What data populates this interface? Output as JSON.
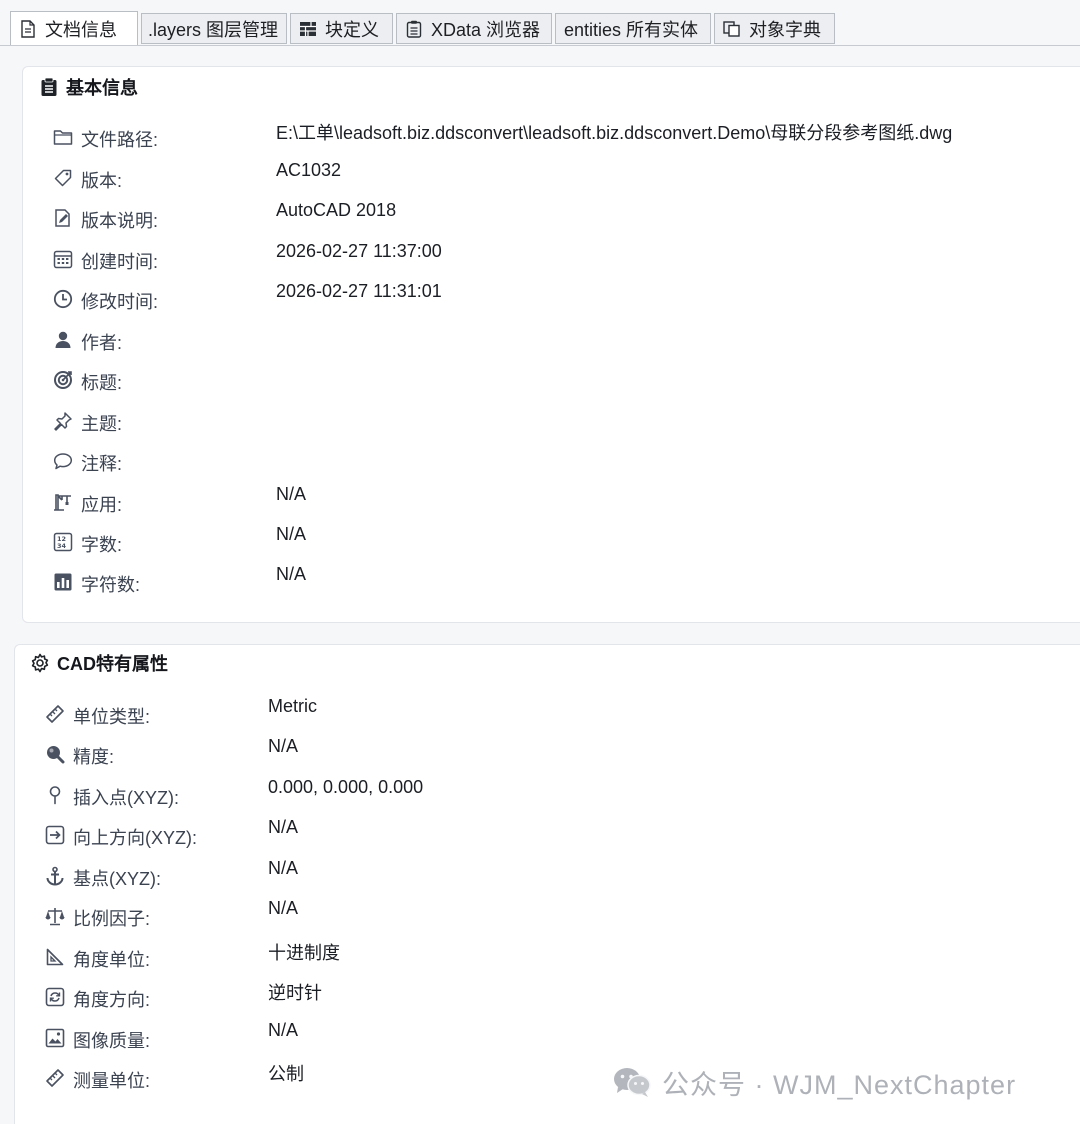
{
  "tabs": [
    {
      "label": "文档信息",
      "icon": "document-icon",
      "active": true
    },
    {
      "label": ".layers 图层管理",
      "icon": "",
      "active": false
    },
    {
      "label": "块定义",
      "icon": "block-table-icon",
      "active": false
    },
    {
      "label": "XData 浏览器",
      "icon": "clipboard-list-icon",
      "active": false
    },
    {
      "label": "entities 所有实体",
      "icon": "",
      "active": false
    },
    {
      "label": "对象字典",
      "icon": "copy-icon",
      "active": false
    }
  ],
  "basic_info": {
    "title": "基本信息",
    "title_icon": "clipboard-icon",
    "rows": [
      {
        "icon": "folder-icon",
        "label": "文件路径:",
        "value": "E:\\工单\\leadsoft.biz.ddsconvert\\leadsoft.biz.ddsconvert.Demo\\母联分段参考图纸.dwg"
      },
      {
        "icon": "tag-icon",
        "label": "版本:",
        "value": "AC1032"
      },
      {
        "icon": "edit-document-icon",
        "label": "版本说明:",
        "value": "AutoCAD 2018"
      },
      {
        "icon": "calendar-icon",
        "label": "创建时间:",
        "value": "2026-02-27 11:37:00"
      },
      {
        "icon": "clock-icon",
        "label": "修改时间:",
        "value": "2026-02-27 11:31:01"
      },
      {
        "icon": "user-icon",
        "label": "作者:",
        "value": ""
      },
      {
        "icon": "target-icon",
        "label": "标题:",
        "value": ""
      },
      {
        "icon": "pin-icon",
        "label": "主题:",
        "value": ""
      },
      {
        "icon": "comment-icon",
        "label": "注释:",
        "value": ""
      },
      {
        "icon": "crane-icon",
        "label": "应用:",
        "value": "N/A"
      },
      {
        "icon": "number-grid-icon",
        "label": "字数:",
        "value": "N/A"
      },
      {
        "icon": "bar-chart-icon",
        "label": "字符数:",
        "value": "N/A"
      }
    ]
  },
  "cad_props": {
    "title": "CAD特有属性",
    "title_icon": "gear-icon",
    "rows": [
      {
        "icon": "ruler-icon",
        "label": "单位类型:",
        "value": "Metric"
      },
      {
        "icon": "magnifier-icon",
        "label": "精度:",
        "value": "N/A"
      },
      {
        "icon": "location-pin-icon",
        "label": "插入点(XYZ):",
        "value": "0.000, 0.000, 0.000"
      },
      {
        "icon": "arrow-right-box-icon",
        "label": "向上方向(XYZ):",
        "value": "N/A"
      },
      {
        "icon": "anchor-icon",
        "label": "基点(XYZ):",
        "value": "N/A"
      },
      {
        "icon": "scale-icon",
        "label": "比例因子:",
        "value": "N/A"
      },
      {
        "icon": "set-square-icon",
        "label": "角度单位:",
        "value": "十进制度"
      },
      {
        "icon": "rotate-box-icon",
        "label": "角度方向:",
        "value": "逆时针"
      },
      {
        "icon": "image-icon",
        "label": "图像质量:",
        "value": "N/A"
      },
      {
        "icon": "ruler-icon",
        "label": "测量单位:",
        "value": "公制"
      }
    ]
  },
  "watermark": {
    "text": "公众号 · WJM_NextChapter",
    "icon": "wechat-icon"
  },
  "colors": {
    "icon": "#4a5160",
    "label": "#3b4250",
    "value": "#1b1e24",
    "tab_border": "#b9bdc4",
    "watermark": "#aeb2b8"
  }
}
